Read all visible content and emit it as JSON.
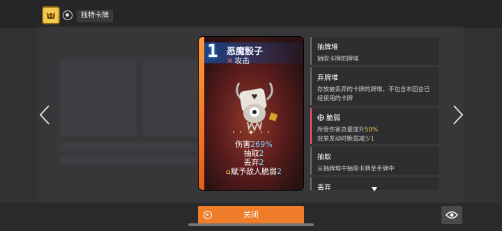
{
  "header": {
    "title": "独特卡牌",
    "badge_icon": "golden-cat-badge-icon"
  },
  "card": {
    "cost": "1",
    "name": "恶魔骰子",
    "type_icon": "crossed-swords-icon",
    "type": "攻击",
    "stats": {
      "damage_label": "伤害",
      "damage_value": "269%",
      "draw_label": "抽取",
      "draw_value": "2",
      "discard_label": "丢弃",
      "discard_value": "2",
      "effect_label": "赋予敌人脆弱",
      "effect_value": "2"
    },
    "colors": {
      "frame": "#ef7d2a",
      "accent": "#7ad0ff"
    }
  },
  "info": [
    {
      "title": "抽牌堆",
      "desc": "抽取卡牌的牌堆"
    },
    {
      "title": "弃牌堆",
      "desc": "存放被丢弃的卡牌的牌堆，不包含本回合已经使用的卡牌"
    },
    {
      "title": "脆弱",
      "icon": "crosshair-icon",
      "desc_line1_prefix": "所受伤害总量提升",
      "desc_line1_value": "50%",
      "desc_line2_prefix": "效果发动时脆弱减少",
      "desc_line2_value": "1"
    },
    {
      "title": "抽取",
      "desc": "从抽牌堆中抽取卡牌至手牌中"
    },
    {
      "title": "丢弃"
    }
  ],
  "footer": {
    "close_label": "关闭",
    "eye_icon": "eye-icon"
  }
}
